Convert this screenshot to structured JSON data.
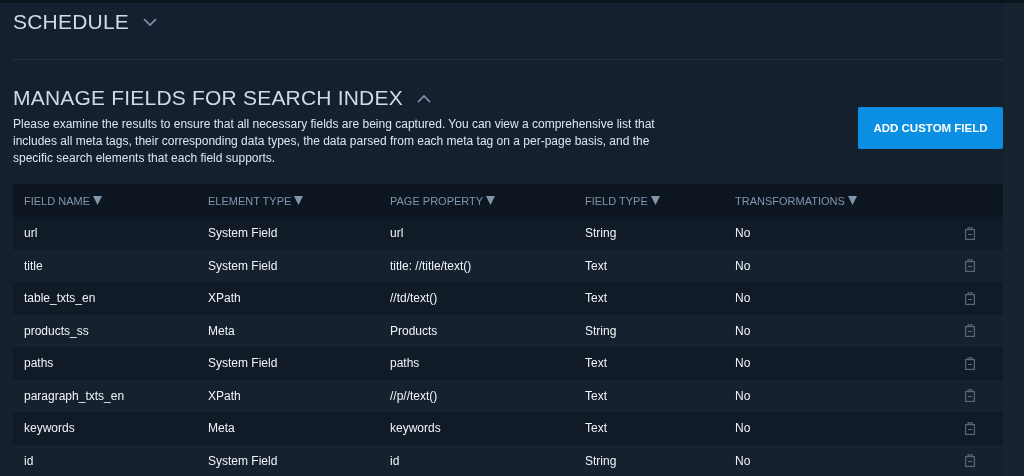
{
  "sections": [
    {
      "title": "SCHEDULE",
      "expanded": false
    },
    {
      "title": "MANAGE FIELDS FOR SEARCH INDEX",
      "expanded": true
    }
  ],
  "description": "Please examine the results to ensure that all necessary fields are being captured. You can view a comprehensive list that includes all meta tags, their corresponding data types, the data parsed from each meta tag on a per-page basis, and the specific search elements that each field supports.",
  "add_button": "ADD CUSTOM FIELD",
  "table": {
    "columns": [
      "FIELD NAME",
      "ELEMENT TYPE",
      "PAGE PROPERTY",
      "FIELD TYPE",
      "TRANSFORMATIONS"
    ],
    "rows": [
      [
        "url",
        "System Field",
        "url",
        "String",
        "No"
      ],
      [
        "title",
        "System Field",
        "title: //title/text()",
        "Text",
        "No"
      ],
      [
        "table_txts_en",
        "XPath",
        "//td/text()",
        "Text",
        "No"
      ],
      [
        "products_ss",
        "Meta",
        "Products",
        "String",
        "No"
      ],
      [
        "paths",
        "System Field",
        "paths",
        "Text",
        "No"
      ],
      [
        "paragraph_txts_en",
        "XPath",
        "//p//text()",
        "Text",
        "No"
      ],
      [
        "keywords",
        "Meta",
        "keywords",
        "Text",
        "No"
      ],
      [
        "id",
        "System Field",
        "id",
        "String",
        "No"
      ]
    ]
  }
}
